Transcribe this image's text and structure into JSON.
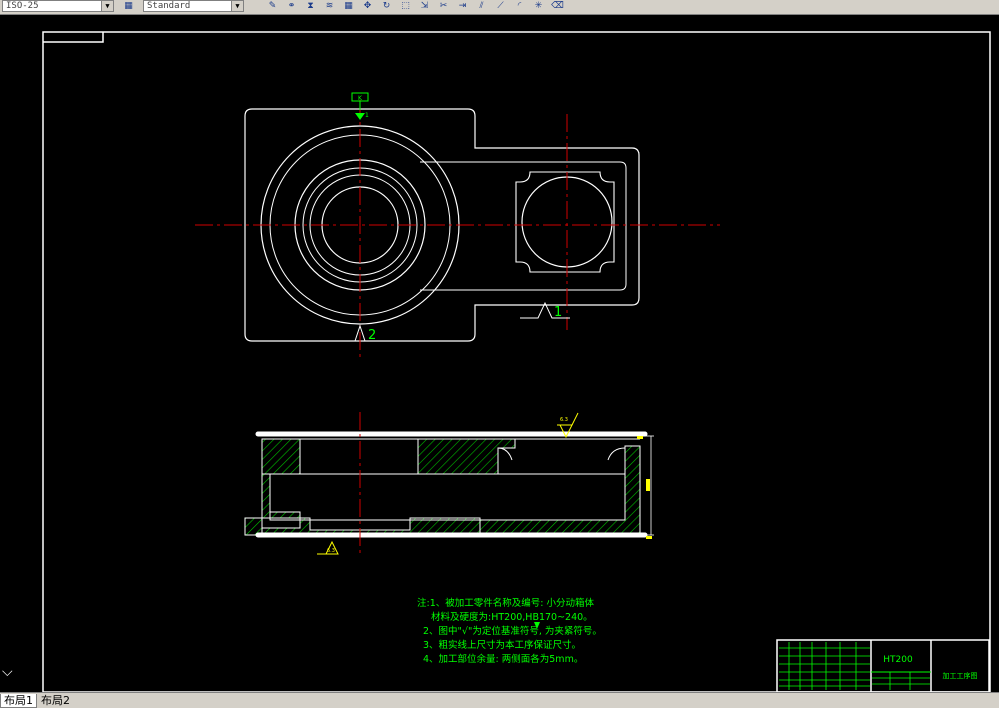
{
  "toolbar": {
    "dimstyle_value": "ISO-25",
    "textstyle_value": "Standard",
    "icons": [
      "dimstyle-icon",
      "pencil-icon",
      "link-icon",
      "mirror-icon",
      "offset-icon",
      "array-icon",
      "move-icon",
      "rotate-icon",
      "scale-icon",
      "stretch-icon",
      "trim-icon",
      "extend-icon",
      "break-icon",
      "chamfer-icon",
      "fillet-icon",
      "explode-icon",
      "eraser-icon"
    ]
  },
  "drawing": {
    "datum_flag": "K",
    "datum1_label": "1",
    "datum2_label": "2",
    "roughness_values": [
      "6.3",
      "6.3"
    ],
    "notes": [
      "注:1、被加工零件名称及编号: 小分动箱体",
      "材料及硬度为:HT200,HB170~240。",
      "2、图中\"√\"为定位基准符号,  为夹紧符号。",
      "3、粗实线上尺寸为本工序保证尺寸。",
      "4、加工部位余量: 两侧面各为5mm。"
    ],
    "title_block": {
      "material": "HT200",
      "drawing_name": "加工工序图"
    },
    "colors": {
      "outline": "#ffffff",
      "centerline": "#d00000",
      "hatch": "#00c000",
      "notes": "#00ff00",
      "dimension": "#ffff00"
    }
  },
  "tabs": [
    {
      "label": "布局1",
      "active": true
    },
    {
      "label": "布局2",
      "active": false
    }
  ]
}
